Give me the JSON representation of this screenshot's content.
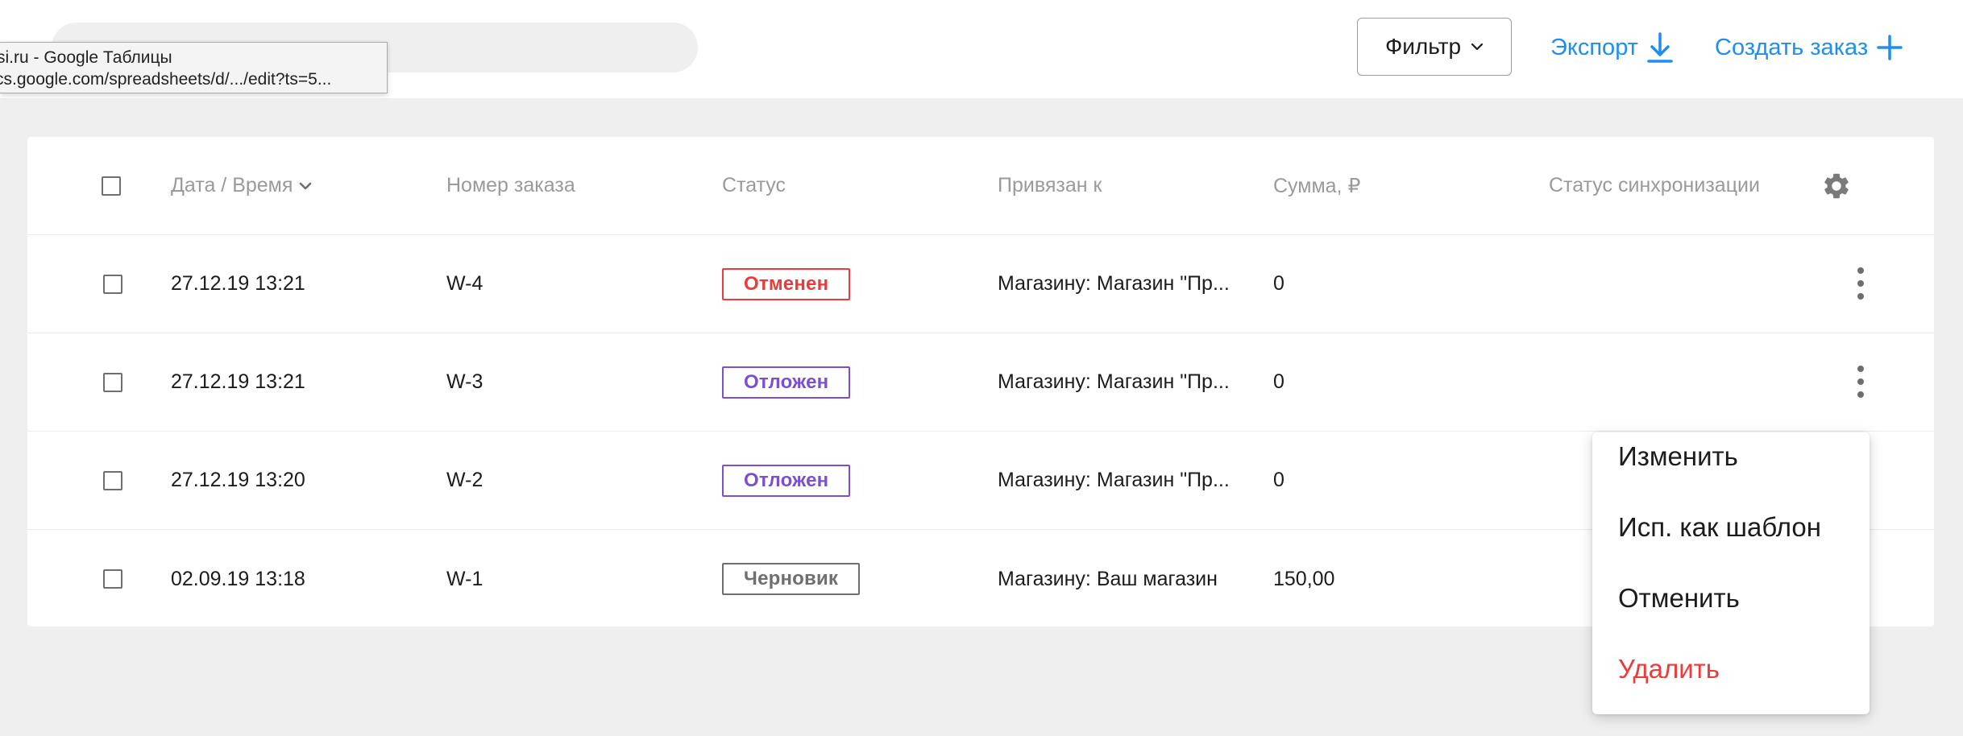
{
  "tooltip": {
    "line1": "si.ru - Google Таблицы",
    "line2": "cs.google.com/spreadsheets/d/.../edit?ts=5..."
  },
  "toolbar": {
    "filter_label": "Фильтр",
    "export_label": "Экспорт",
    "create_label": "Создать заказ"
  },
  "table": {
    "columns": {
      "date": "Дата / Время",
      "number": "Номер заказа",
      "status": "Статус",
      "linked": "Привязан к",
      "sum": "Сумма, ₽",
      "sync": "Статус синхронизации"
    },
    "rows": [
      {
        "date": "27.12.19 13:21",
        "number": "W-4",
        "status": "Отменен",
        "linked": "Магазину: Магазин \"Пр...",
        "sum": "0"
      },
      {
        "date": "27.12.19 13:21",
        "number": "W-3",
        "status": "Отложен",
        "linked": "Магазину: Магазин \"Пр...",
        "sum": "0"
      },
      {
        "date": "27.12.19 13:20",
        "number": "W-2",
        "status": "Отложен",
        "linked": "Магазину: Магазин \"Пр...",
        "sum": "0"
      },
      {
        "date": "02.09.19 13:18",
        "number": "W-1",
        "status": "Черновик",
        "linked": "Магазину: Ваш магазин",
        "sum": "150,00"
      }
    ]
  },
  "context_menu": {
    "items": [
      "Изменить",
      "Исп. как шаблон",
      "Отменить",
      "Удалить"
    ]
  },
  "colors": {
    "accent": "#1f8ef1",
    "status_cancelled": "#ee3a3a",
    "status_postponed": "#7a4fd6",
    "status_draft": "#6f6f6f",
    "danger": "#ee3a3a"
  }
}
